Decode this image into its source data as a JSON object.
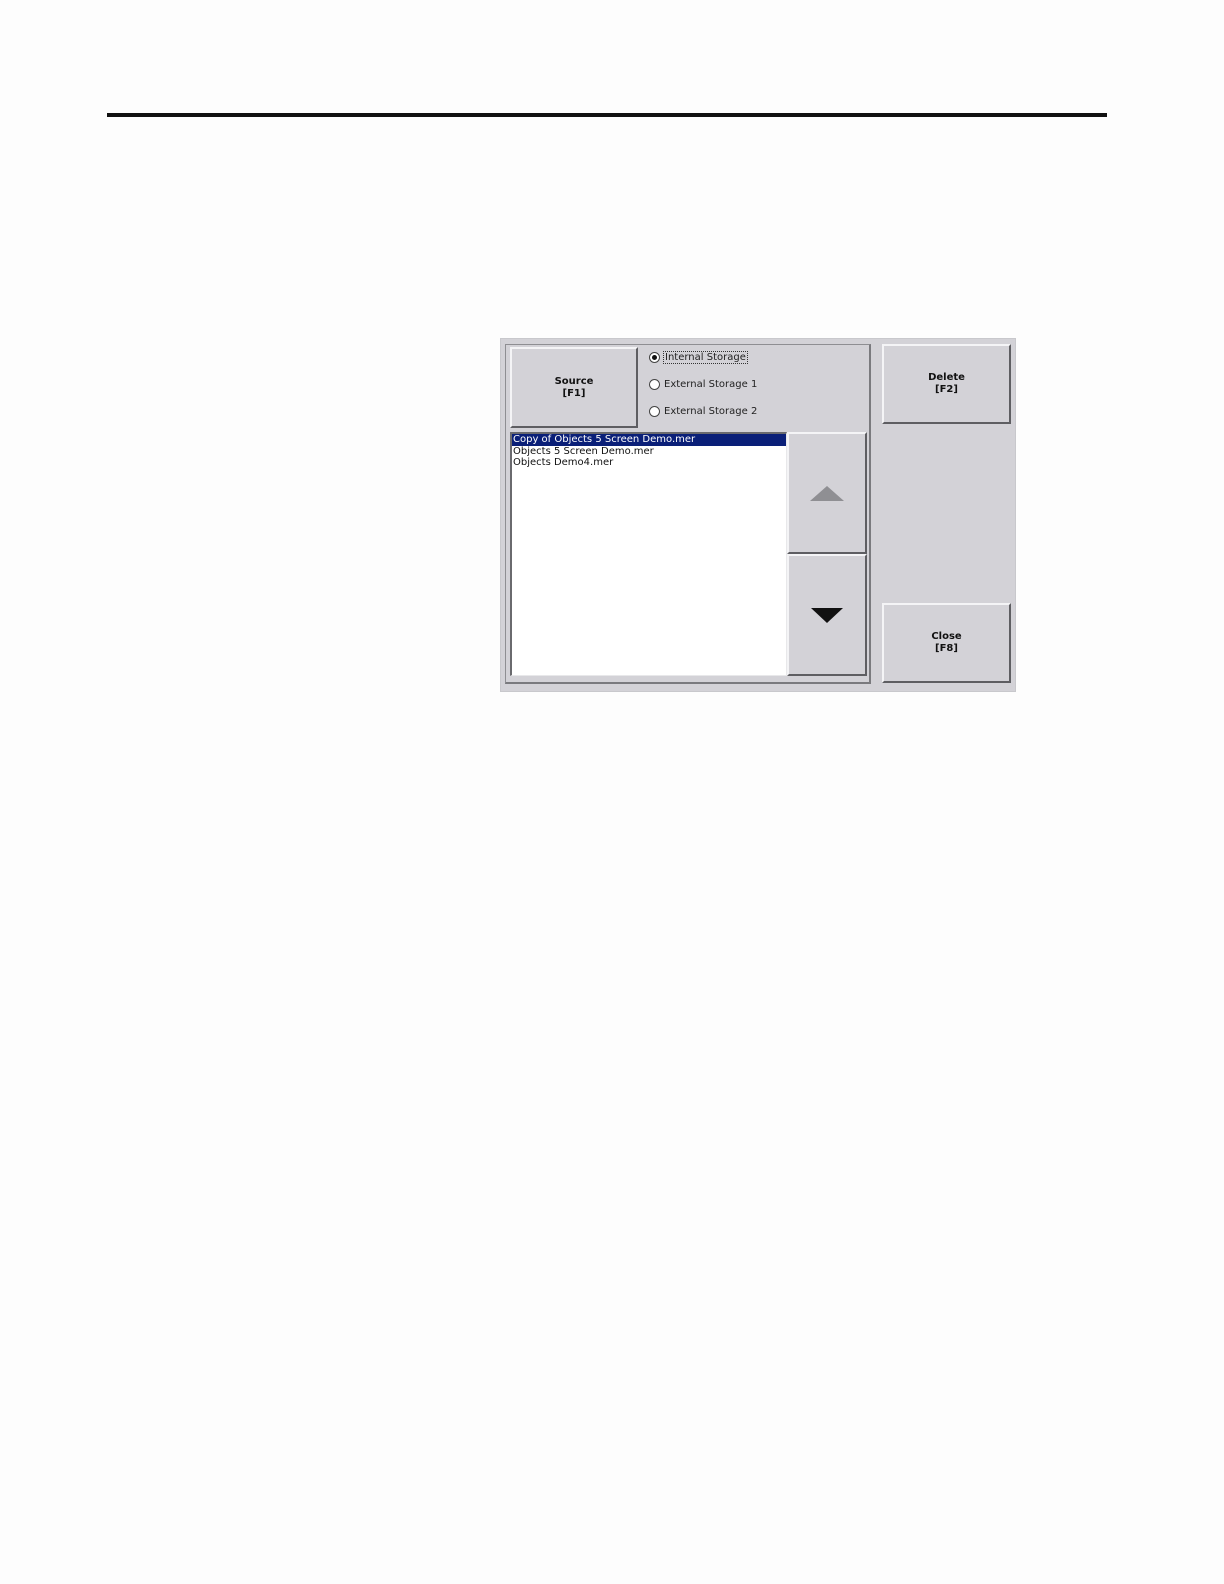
{
  "dialog": {
    "source_button": {
      "line1": "Source",
      "line2": "[F1]"
    },
    "delete_button": {
      "line1": "Delete",
      "line2": "[F2]"
    },
    "close_button": {
      "line1": "Close",
      "line2": "[F8]"
    },
    "storage_options": [
      {
        "label": "Internal Storage",
        "checked": true
      },
      {
        "label": "External Storage 1",
        "checked": false
      },
      {
        "label": "External Storage 2",
        "checked": false
      }
    ],
    "files": [
      "Copy of Objects 5 Screen Demo.mer",
      "Objects 5 Screen Demo.mer",
      "Objects Demo4.mer"
    ],
    "selected_file_index": 0
  },
  "icons": {
    "scroll_up": "triangle-up-icon",
    "scroll_down": "triangle-down-icon"
  }
}
